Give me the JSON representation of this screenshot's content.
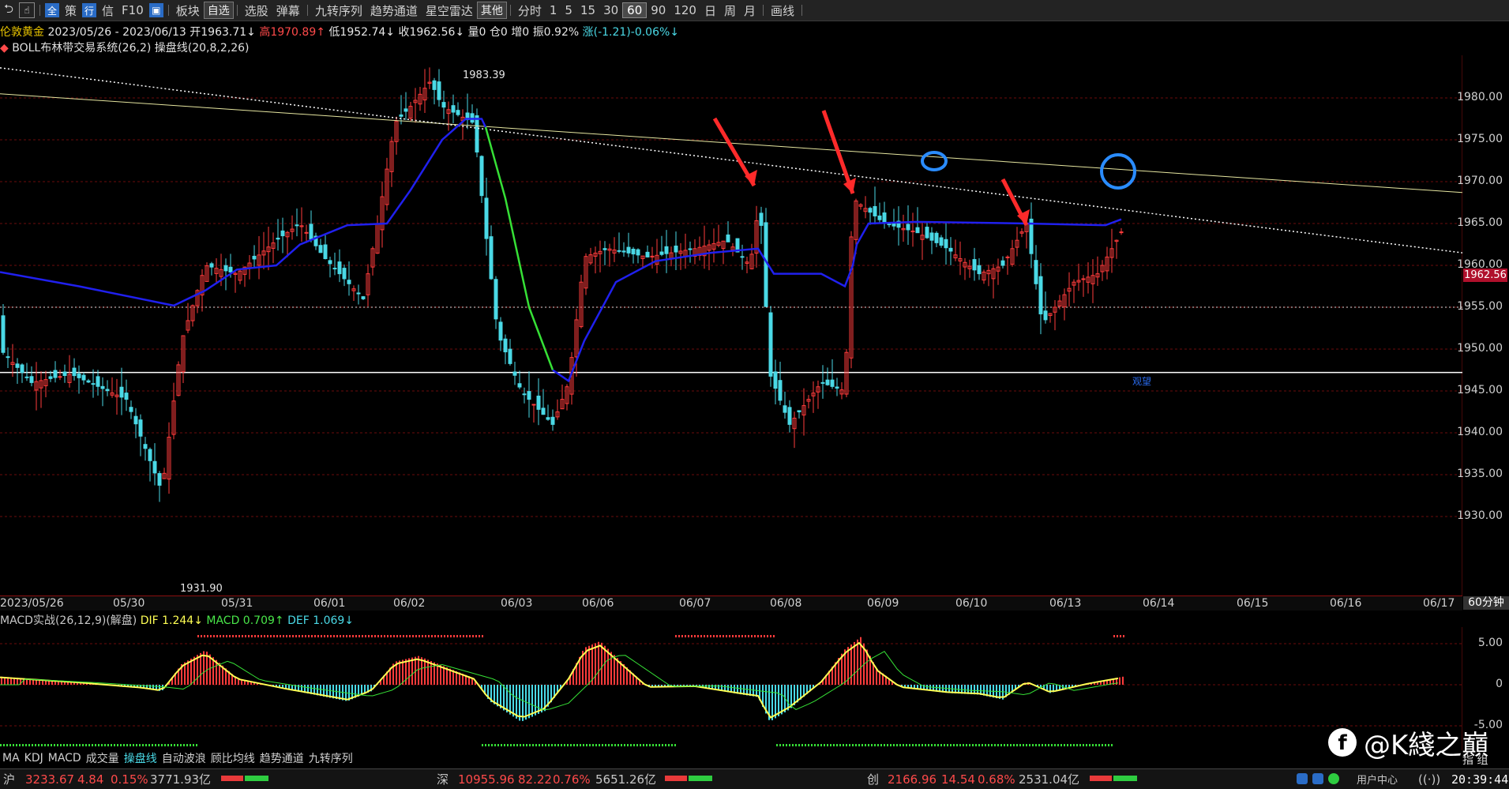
{
  "toolbar": {
    "items": [
      "板块",
      "选股",
      "弹幕",
      "九转序列",
      "趋势通道",
      "星空雷达"
    ],
    "icons": [
      "全",
      "策",
      "行",
      "信",
      "F10"
    ],
    "select_zixuan": "自选",
    "select_other": "其他",
    "periods": [
      "分时",
      "1",
      "5",
      "15",
      "30",
      "60",
      "90",
      "120",
      "日",
      "周",
      "月"
    ],
    "active_period": "60",
    "draw": "画线"
  },
  "header": {
    "symbol": "伦敦黄金",
    "range": "2023/05/26 - 2023/06/13",
    "open": "开1963.71↓",
    "high": "高1970.89↑",
    "low": "低1952.74↓",
    "close": "收1962.56↓",
    "vol": "量0",
    "pos": "仓0",
    "add": "增0",
    "amp": "振0.92%",
    "chg": "涨(-1.21)-0.06%↓",
    "indicator": "BOLL布林带交易系统(26,2)",
    "indicator2": "操盘线(20,8,2,26)"
  },
  "price_axis": {
    "labels": [
      "1980.00",
      "1975.00",
      "1970.00",
      "1965.00",
      "1960.00",
      "1955.00",
      "1950.00",
      "1945.00",
      "1940.00",
      "1935.00",
      "1930.00"
    ],
    "current": "1962.56"
  },
  "annotations": {
    "high": "1983.39",
    "low": "1931.90",
    "tag": "观望"
  },
  "date_axis": {
    "labels": [
      "2023/05/26",
      "05/30",
      "05/31",
      "06/01",
      "06/02",
      "06/03",
      "06/06",
      "06/07",
      "06/08",
      "06/09",
      "06/10",
      "06/13",
      "06/14",
      "06/15",
      "06/16",
      "06/17"
    ],
    "period": "60分钟"
  },
  "macd": {
    "title": "MACD实战(26,12,9)(解盘)",
    "dif": "DIF 1.244↓",
    "macd": "MACD 0.709↑",
    "def": "DEF 1.069↓",
    "labels": [
      "5.00",
      "0",
      "-5.00"
    ]
  },
  "tabs": [
    "MA",
    "KDJ",
    "MACD",
    "成交量",
    "操盘线",
    "自动波浪",
    "顾比均线",
    "趋势通道",
    "九转序列"
  ],
  "active_tab": "操盘线",
  "side_tab": "指 组",
  "status": {
    "sh_label": "沪",
    "sh_value": "3233.67",
    "sh_chg": "4.84",
    "sh_pct": "0.15%",
    "sh_amt": "3771.93亿",
    "sz_label": "深",
    "sz_value": "10955.96",
    "sz_chg": "82.22",
    "sz_pct": "0.76%",
    "sz_amt": "5651.26亿",
    "cy_label": "创",
    "cy_value": "2166.96",
    "cy_chg": "14.54",
    "cy_pct": "0.68%",
    "cy_amt": "2531.04亿",
    "user": "用户中心",
    "time": "20:39:44"
  },
  "watermark": "@K綫之巔",
  "colors": {
    "up": "#ff3b3b",
    "down": "#4ad9e6",
    "boll": "#2222ee",
    "accent": "#e6c200"
  }
}
